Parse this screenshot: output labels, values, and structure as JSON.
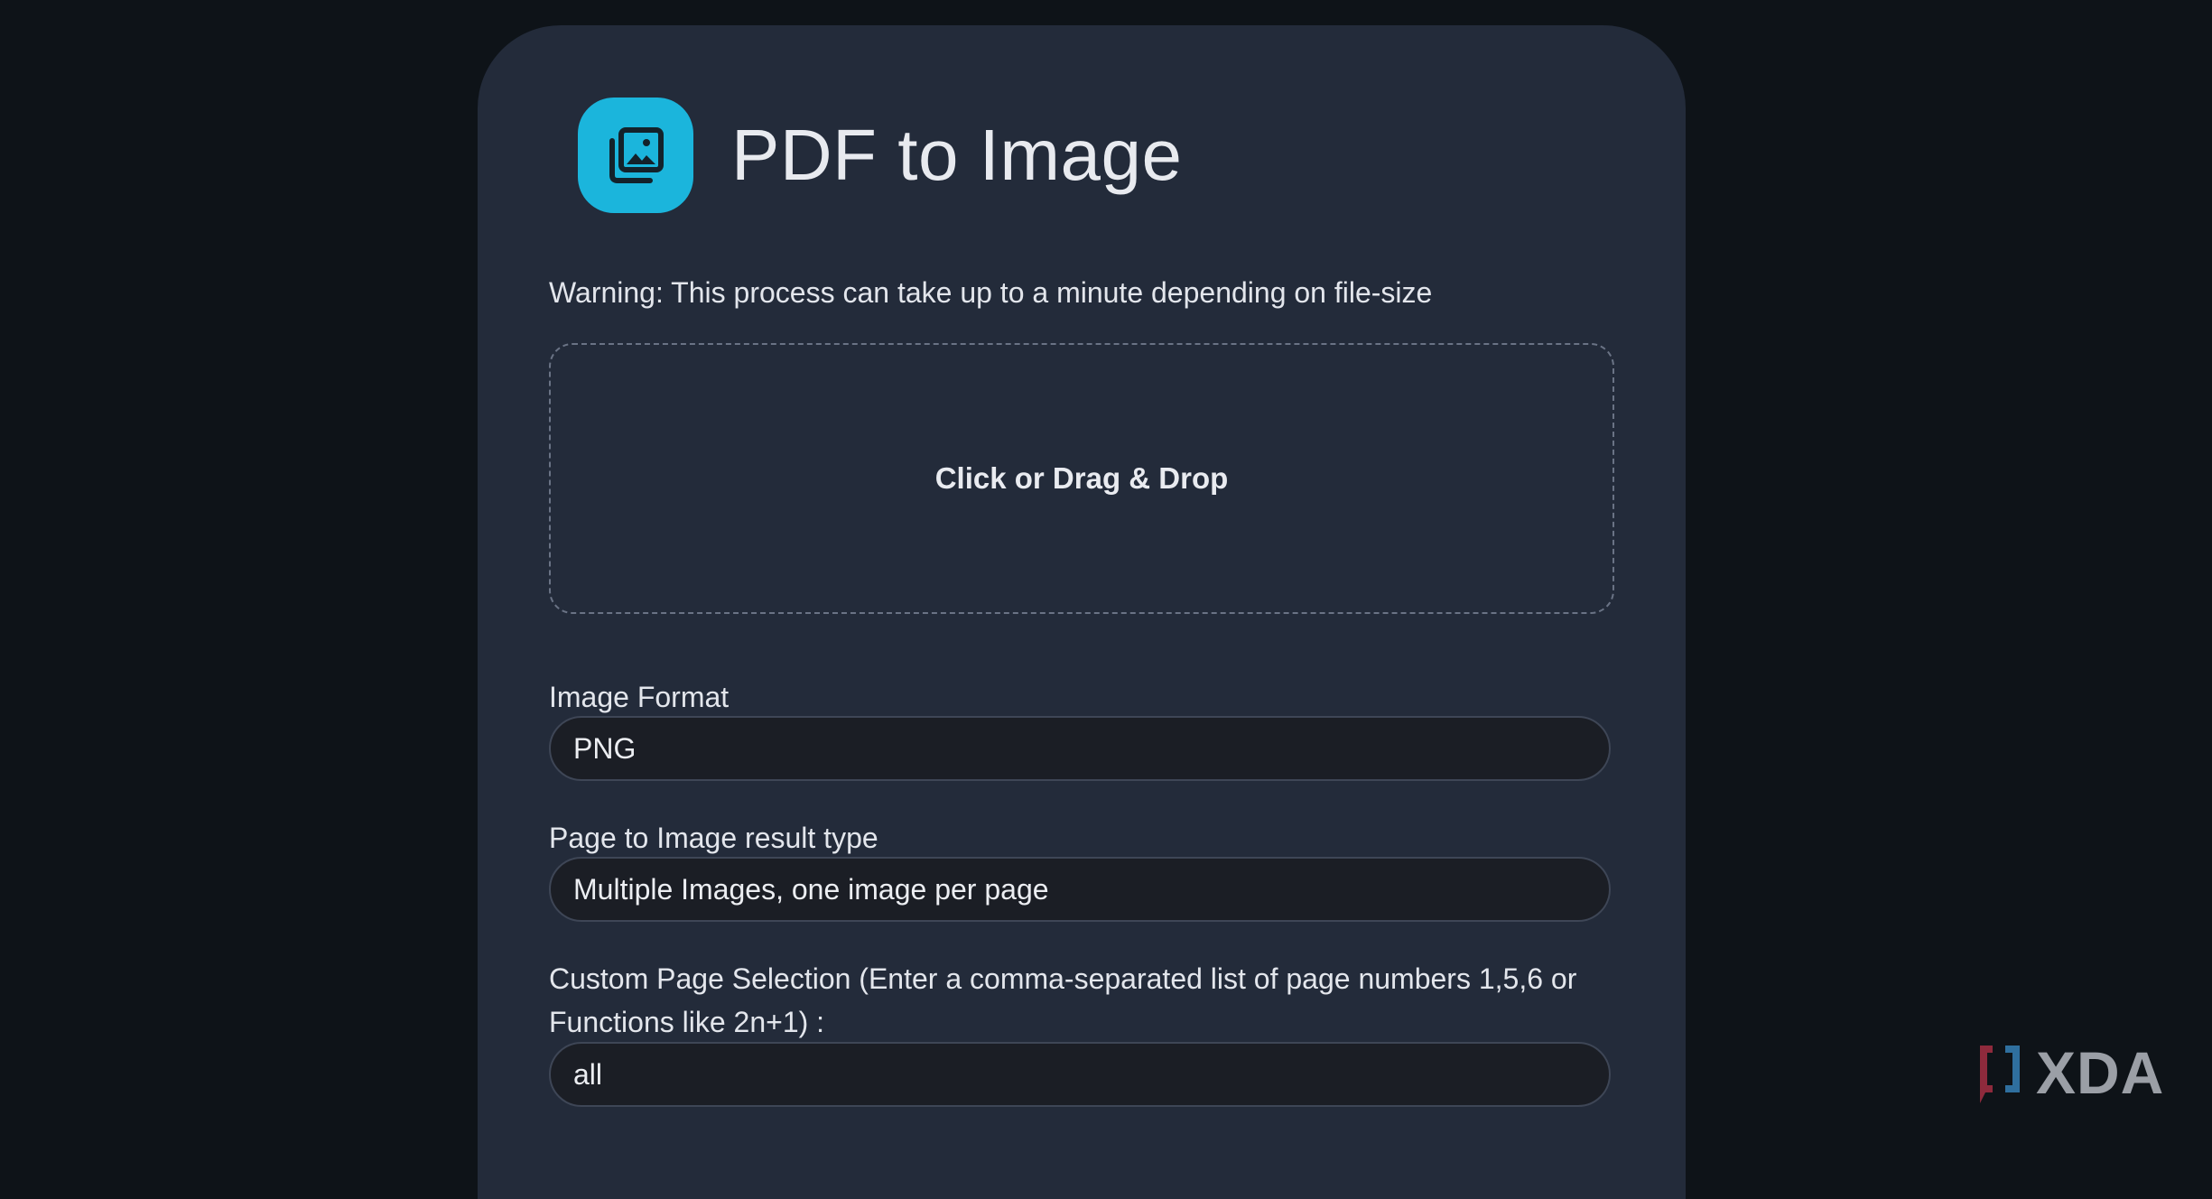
{
  "header": {
    "title": "PDF to Image",
    "icon": "image-stack-icon",
    "icon_color": "#1bb5dc"
  },
  "warning": "Warning: This process can take up to a minute depending on file-size",
  "dropzone": {
    "label": "Click or Drag & Drop"
  },
  "form": {
    "image_format": {
      "label": "Image Format",
      "value": "PNG"
    },
    "result_type": {
      "label": "Page to Image result type",
      "value": "Multiple Images, one image per page"
    },
    "page_selection": {
      "label": "Custom Page Selection (Enter a comma-separated list of page numbers 1,5,6 or Functions like 2n+1) :",
      "value": "all"
    }
  },
  "watermark": {
    "text": "XDA"
  }
}
